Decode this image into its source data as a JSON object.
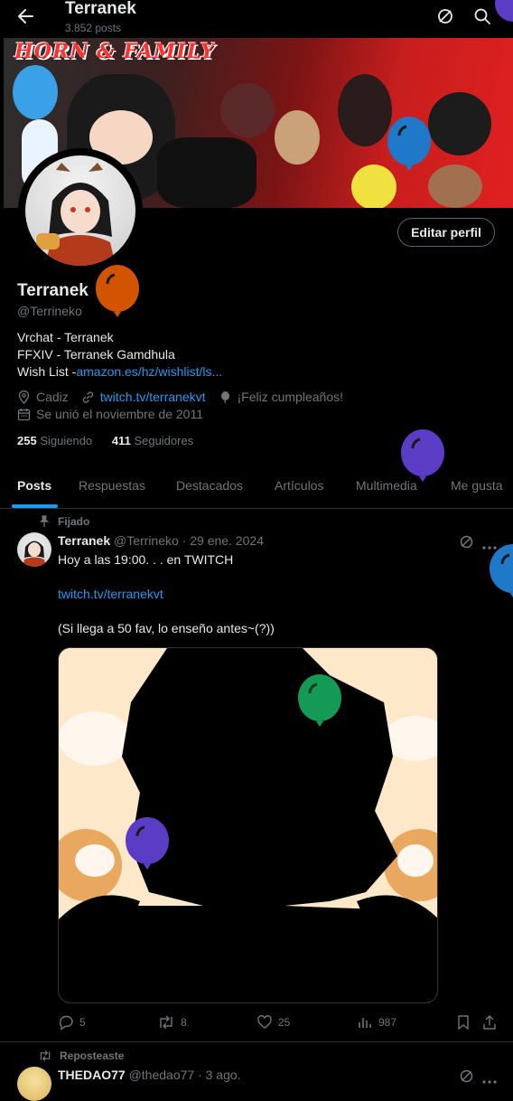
{
  "header": {
    "title": "Terranek",
    "post_count": "3.852 posts"
  },
  "banner": {
    "text": "HORN & FAMILY"
  },
  "profile": {
    "edit_button": "Editar perfil",
    "name": "Terranek",
    "handle": "@Terrineko",
    "bio_line1": "Vrchat - Terranek",
    "bio_line2": "FFXIV - Terranek Gamdhula",
    "bio_line3_prefix": "Wish List -",
    "bio_line3_link": "amazon.es/hz/wishlist/ls...",
    "location": "Cadiz",
    "website": "twitch.tv/terranekvt",
    "birthday": "¡Feliz cumpleaños!",
    "joined": "Se unió el noviembre de 2011",
    "following_count": "255",
    "following_label": "Siguiendo",
    "followers_count": "411",
    "followers_label": "Seguidores"
  },
  "tabs": [
    "Posts",
    "Respuestas",
    "Destacados",
    "Artículos",
    "Multimedia",
    "Me gusta"
  ],
  "pinned_post": {
    "pinned_label": "Fijado",
    "author": "Terranek",
    "handle_date": "@Terrineko · 29 ene. 2024",
    "line1": "Hoy a las 19:00. . . en TWITCH",
    "link": "twitch.tv/terranekvt",
    "line3": "(Si llega a 50 fav, lo enseño antes~(?))",
    "replies": "5",
    "reposts": "8",
    "likes": "25",
    "views": "987"
  },
  "next_post": {
    "repost_label": "Reposteaste",
    "author": "THEDAO77",
    "handle_date": "@thedao77 · 3 ago."
  },
  "colors": {
    "accent": "#1d9bf0",
    "background": "#000000",
    "muted": "#71767b",
    "balloon_orange": "#d35400",
    "balloon_purple": "#5b3cc4",
    "balloon_blue": "#1f78c8",
    "balloon_green": "#159a55"
  }
}
